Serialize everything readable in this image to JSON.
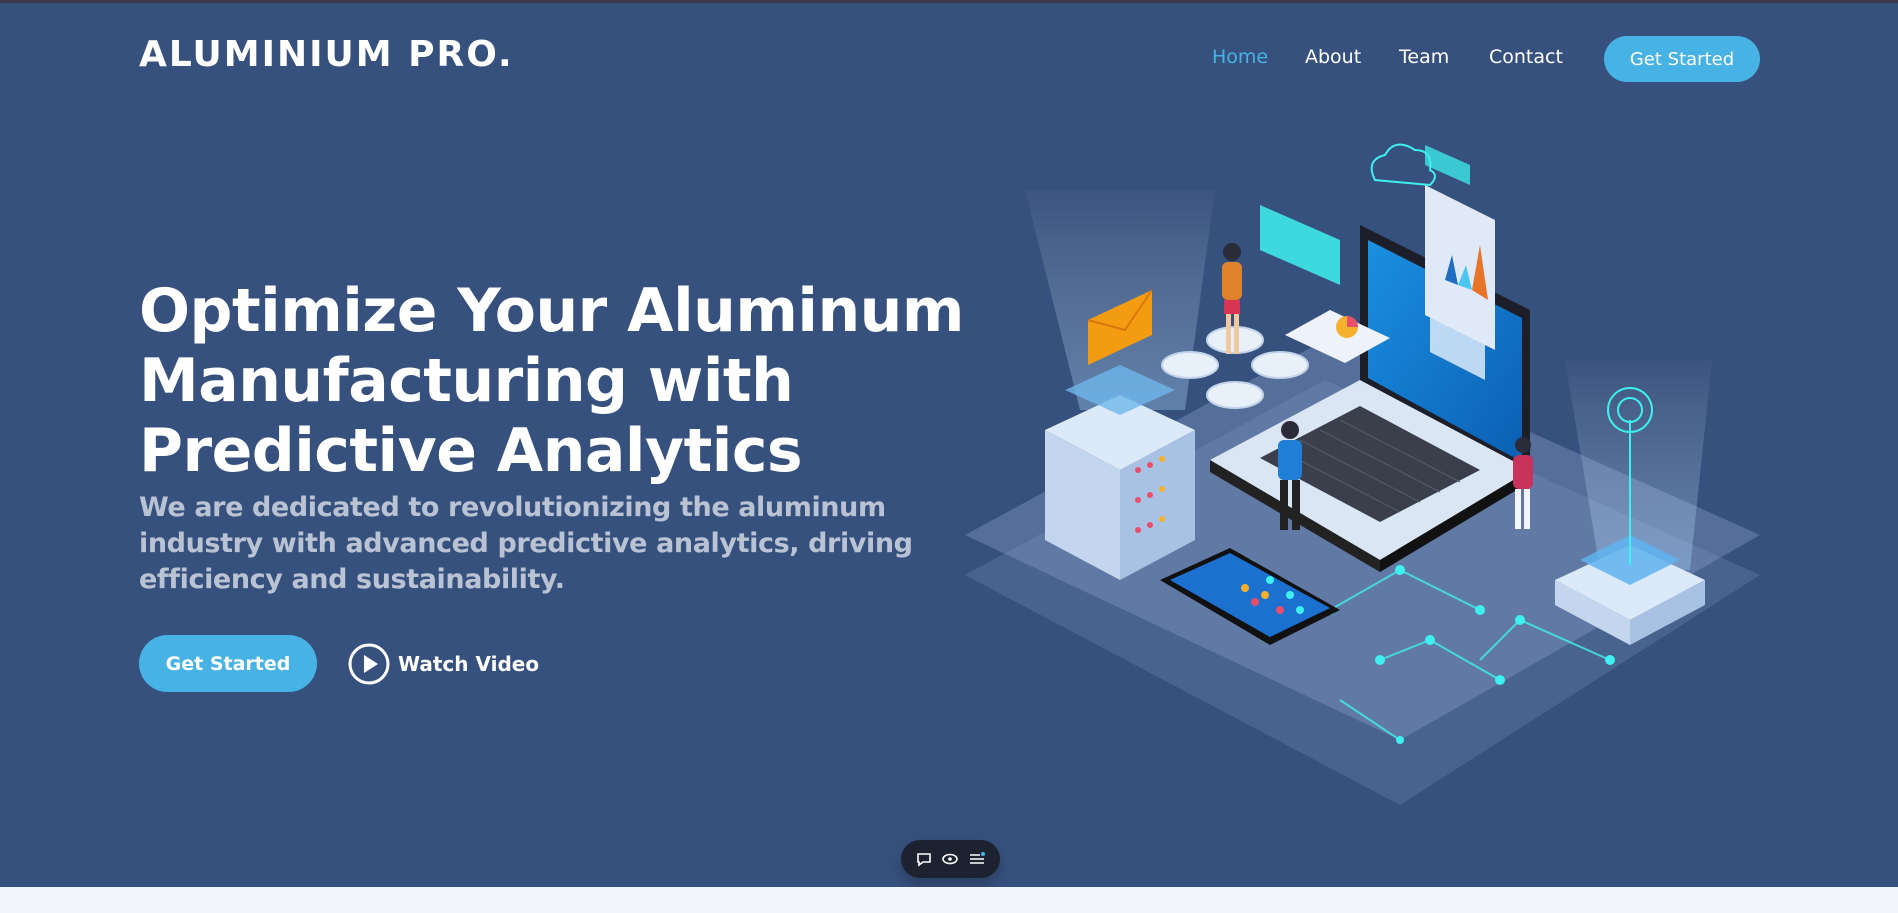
{
  "brand": {
    "logo": "ALUMINIUM PRO."
  },
  "nav": {
    "items": [
      {
        "label": "Home",
        "active": true
      },
      {
        "label": "About",
        "active": false
      },
      {
        "label": "Team",
        "active": false
      },
      {
        "label": "Contact",
        "active": false
      }
    ],
    "cta_label": "Get Started"
  },
  "hero": {
    "title_lines": [
      "Optimize Your Aluminum",
      "Manufacturing with",
      "Predictive Analytics"
    ],
    "subtitle": "We are dedicated to revolutionizing the aluminum industry with advanced predictive analytics, driving efficiency and sustainability.",
    "cta_label": "Get Started",
    "video_label": "Watch Video"
  },
  "toolbar": {
    "icons": [
      "comment-icon",
      "eye-icon",
      "menu-icon"
    ]
  },
  "colors": {
    "background": "#37517e",
    "accent": "#47b2e4",
    "footer": "#f3f5fa"
  }
}
